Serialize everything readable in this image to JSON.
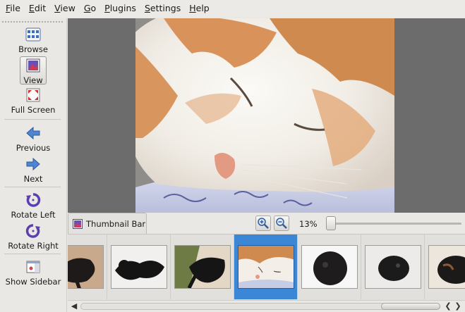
{
  "menubar": {
    "items": [
      {
        "label": "File",
        "key": "F"
      },
      {
        "label": "Edit",
        "key": "E"
      },
      {
        "label": "View",
        "key": "V"
      },
      {
        "label": "Go",
        "key": "G"
      },
      {
        "label": "Plugins",
        "key": "P"
      },
      {
        "label": "Settings",
        "key": "S"
      },
      {
        "label": "Help",
        "key": "H"
      }
    ]
  },
  "sidebar": {
    "browse_label": "Browse",
    "view_label": "View",
    "fullscreen_label": "Full Screen",
    "previous_label": "Previous",
    "next_label": "Next",
    "rotate_left_label": "Rotate Left",
    "rotate_right_label": "Rotate Right",
    "show_sidebar_label": "Show Sidebar",
    "active_item": "View"
  },
  "thumbnail_bar": {
    "tab_label": "Thumbnail Bar",
    "zoom_label": "13%",
    "zoom_level": 0.13,
    "selected_index": 3,
    "thumbnails": [
      {
        "subject": "black cat on rug"
      },
      {
        "subject": "black cat on white bed"
      },
      {
        "subject": "black cat on cushion"
      },
      {
        "subject": "orange and white cat sleeping"
      },
      {
        "subject": "black cat curled on white"
      },
      {
        "subject": "black cat curled on blanket"
      },
      {
        "subject": "black cat partial"
      }
    ]
  },
  "colors": {
    "selection": "#3b87d6",
    "viewer_bg": "#6c6c6c",
    "window_bg": "#e9e8e4"
  }
}
